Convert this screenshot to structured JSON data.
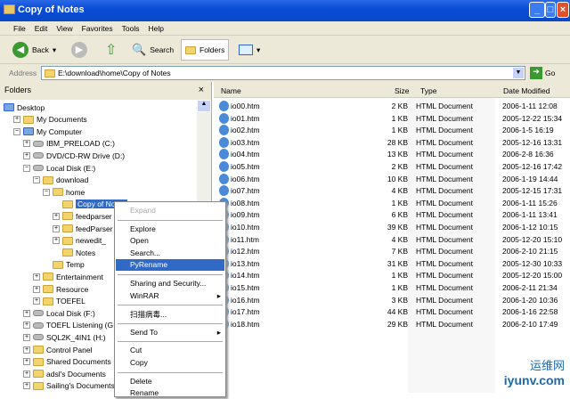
{
  "window": {
    "title": "Copy of Notes"
  },
  "menu": [
    "File",
    "Edit",
    "View",
    "Favorites",
    "Tools",
    "Help"
  ],
  "toolbar": {
    "back": "Back",
    "search": "Search",
    "folders": "Folders"
  },
  "address": {
    "label": "Address",
    "value": "E:\\download\\home\\Copy of Notes",
    "go": "Go"
  },
  "folders_pane": {
    "title": "Folders",
    "close": "×",
    "tree": [
      {
        "label": "Desktop",
        "level": 0,
        "exp": "",
        "icon": "desktop"
      },
      {
        "label": "My Documents",
        "level": 1,
        "exp": "+",
        "icon": "folder"
      },
      {
        "label": "My Computer",
        "level": 1,
        "exp": "-",
        "icon": "computer"
      },
      {
        "label": "IBM_PRELOAD (C:)",
        "level": 2,
        "exp": "+",
        "icon": "drive"
      },
      {
        "label": "DVD/CD-RW Drive (D:)",
        "level": 2,
        "exp": "+",
        "icon": "drive"
      },
      {
        "label": "Local Disk (E:)",
        "level": 2,
        "exp": "-",
        "icon": "drive"
      },
      {
        "label": "download",
        "level": 3,
        "exp": "-",
        "icon": "folder"
      },
      {
        "label": "home",
        "level": 4,
        "exp": "-",
        "icon": "folder"
      },
      {
        "label": "Copy of Notes",
        "level": 5,
        "exp": "",
        "icon": "folder",
        "selected": true
      },
      {
        "label": "feedparser",
        "level": 5,
        "exp": "+",
        "icon": "folder"
      },
      {
        "label": "feedParser",
        "level": 5,
        "exp": "+",
        "icon": "folder"
      },
      {
        "label": "newedit_",
        "level": 5,
        "exp": "+",
        "icon": "folder"
      },
      {
        "label": "Notes",
        "level": 5,
        "exp": "",
        "icon": "folder"
      },
      {
        "label": "Temp",
        "level": 4,
        "exp": "",
        "icon": "folder"
      },
      {
        "label": "Entertainment",
        "level": 3,
        "exp": "+",
        "icon": "folder"
      },
      {
        "label": "Resource",
        "level": 3,
        "exp": "+",
        "icon": "folder"
      },
      {
        "label": "TOEFEL",
        "level": 3,
        "exp": "+",
        "icon": "folder"
      },
      {
        "label": "Local Disk (F:)",
        "level": 2,
        "exp": "+",
        "icon": "drive"
      },
      {
        "label": "TOEFL Listening (G:)",
        "level": 2,
        "exp": "+",
        "icon": "drive"
      },
      {
        "label": "SQL2K_4IN1 (H:)",
        "level": 2,
        "exp": "+",
        "icon": "drive"
      },
      {
        "label": "Control Panel",
        "level": 2,
        "exp": "+",
        "icon": "folder"
      },
      {
        "label": "Shared Documents",
        "level": 2,
        "exp": "+",
        "icon": "folder"
      },
      {
        "label": "adsl's Documents",
        "level": 2,
        "exp": "+",
        "icon": "folder"
      },
      {
        "label": "Sailing's Documents",
        "level": 2,
        "exp": "+",
        "icon": "folder"
      }
    ]
  },
  "columns": {
    "name": "Name",
    "size": "Size",
    "type": "Type",
    "date": "Date Modified"
  },
  "files": [
    [
      "io00.htm",
      "2 KB",
      "HTML Document",
      "2006-1-11 12:08"
    ],
    [
      "io01.htm",
      "1 KB",
      "HTML Document",
      "2005-12-22 15:34"
    ],
    [
      "io02.htm",
      "1 KB",
      "HTML Document",
      "2006-1-5 16:19"
    ],
    [
      "io03.htm",
      "28 KB",
      "HTML Document",
      "2005-12-16 13:31"
    ],
    [
      "io04.htm",
      "13 KB",
      "HTML Document",
      "2006-2-8 16:36"
    ],
    [
      "io05.htm",
      "2 KB",
      "HTML Document",
      "2005-12-16 17:42"
    ],
    [
      "io06.htm",
      "10 KB",
      "HTML Document",
      "2006-1-19 14:44"
    ],
    [
      "io07.htm",
      "4 KB",
      "HTML Document",
      "2005-12-15 17:31"
    ],
    [
      "io08.htm",
      "1 KB",
      "HTML Document",
      "2006-1-11 15:26"
    ],
    [
      "io09.htm",
      "6 KB",
      "HTML Document",
      "2006-1-11 13:41"
    ],
    [
      "io10.htm",
      "39 KB",
      "HTML Document",
      "2006-1-12 10:15"
    ],
    [
      "io11.htm",
      "4 KB",
      "HTML Document",
      "2005-12-20 15:10"
    ],
    [
      "io12.htm",
      "7 KB",
      "HTML Document",
      "2006-2-10 21:15"
    ],
    [
      "io13.htm",
      "31 KB",
      "HTML Document",
      "2005-12-30 10:33"
    ],
    [
      "io14.htm",
      "1 KB",
      "HTML Document",
      "2005-12-20 15:00"
    ],
    [
      "io15.htm",
      "1 KB",
      "HTML Document",
      "2006-2-11 21:34"
    ],
    [
      "io16.htm",
      "3 KB",
      "HTML Document",
      "2006-1-20 10:36"
    ],
    [
      "io17.htm",
      "44 KB",
      "HTML Document",
      "2006-1-16 22:58"
    ],
    [
      "io18.htm",
      "29 KB",
      "HTML Document",
      "2006-2-10 17:49"
    ]
  ],
  "context_menu": [
    {
      "label": "Expand",
      "disabled": true
    },
    {
      "sep": true
    },
    {
      "label": "Explore"
    },
    {
      "label": "Open"
    },
    {
      "label": "Search..."
    },
    {
      "label": "PyRename",
      "highlighted": true
    },
    {
      "sep": true
    },
    {
      "label": "Sharing and Security..."
    },
    {
      "label": "WinRAR",
      "submenu": true
    },
    {
      "sep": true
    },
    {
      "label": "扫描病毒..."
    },
    {
      "sep": true
    },
    {
      "label": "Send To",
      "submenu": true
    },
    {
      "sep": true
    },
    {
      "label": "Cut"
    },
    {
      "label": "Copy"
    },
    {
      "sep": true
    },
    {
      "label": "Delete"
    },
    {
      "label": "Rename"
    }
  ],
  "watermark": {
    "cn": "运维网",
    "url": "iyunv.com"
  },
  "colors": {
    "titlebar": "#0a4cd6",
    "selection": "#316ac5",
    "chrome": "#ece9d8"
  }
}
